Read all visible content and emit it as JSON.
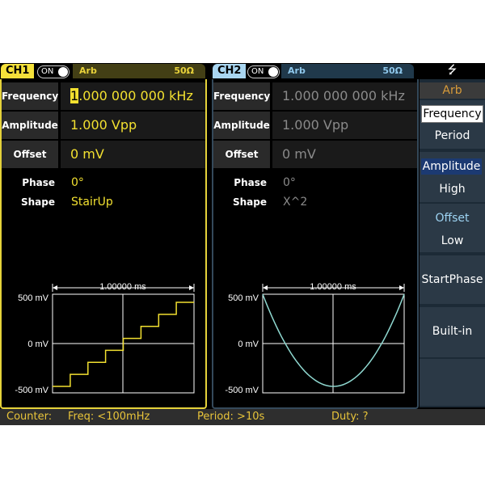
{
  "ch1": {
    "name": "CH1",
    "on_label": "ON",
    "mode": "Arb",
    "impedance": "50Ω",
    "rows": [
      {
        "label": "Frequency",
        "value_cursor": "1",
        "value_rest": ".000 000 000 kHz"
      },
      {
        "label": "Amplitude",
        "value": "1.000 Vpp"
      },
      {
        "label": "Offset",
        "value": "0 mV"
      }
    ],
    "phase_label": "Phase",
    "phase_value": "0°",
    "shape_label": "Shape",
    "shape_value": "StairUp",
    "plot": {
      "timebase": "1.00000 ms",
      "y_top": "500 mV",
      "y_mid": "0 mV",
      "y_bot": "-500 mV"
    }
  },
  "ch2": {
    "name": "CH2",
    "on_label": "ON",
    "mode": "Arb",
    "impedance": "50Ω",
    "rows": [
      {
        "label": "Frequency",
        "value": "1.000 000 000 kHz"
      },
      {
        "label": "Amplitude",
        "value": "1.000 Vpp"
      },
      {
        "label": "Offset",
        "value": "0 mV"
      }
    ],
    "phase_label": "Phase",
    "phase_value": "0°",
    "shape_label": "Shape",
    "shape_value": "X^2",
    "plot": {
      "timebase": "1.00000 ms",
      "y_top": "500 mV",
      "y_mid": "0 mV",
      "y_bot": "-500 mV"
    }
  },
  "menu": {
    "usb_icon": "usb-icon",
    "title": "Arb",
    "keys": [
      {
        "top": "Frequency",
        "bottom": "Period"
      },
      {
        "top": "Amplitude",
        "bottom": "High"
      },
      {
        "top": "Offset",
        "bottom": "Low"
      },
      {
        "single": "StartPhase"
      },
      {
        "single": "Built-in"
      },
      {
        "single": ""
      }
    ]
  },
  "counter": {
    "label": "Counter:",
    "freq": "Freq: <100mHz",
    "period": "Period: >10s",
    "duty": "Duty: ?"
  },
  "colors": {
    "ch1": "#f2e030",
    "ch2": "#a9d6f1",
    "wave2": "#8fd8d0"
  },
  "waveforms": {
    "ch1_shape": "StairUp",
    "ch1_steps": 8,
    "ch2_shape": "X^2"
  }
}
